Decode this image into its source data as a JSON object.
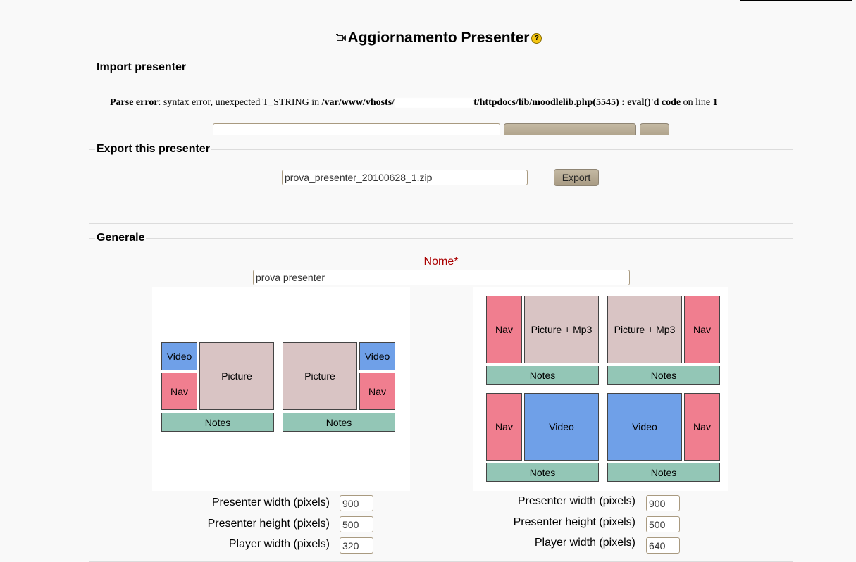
{
  "page": {
    "title": "Aggiornamento Presenter",
    "help_icon_glyph": "?"
  },
  "import_section": {
    "legend": "Import presenter",
    "error_label": "Parse error",
    "error_message": ": syntax error, unexpected T_STRING in ",
    "error_path_start": "/var/www/vhosts/",
    "error_path_end": "t/httpdocs/lib/moodlelib.php(5545) : eval()'d code",
    "error_on_line": " on line ",
    "error_line": "1"
  },
  "export_section": {
    "legend": "Export this presenter",
    "filename_value": "prova_presenter_20100628_1.zip",
    "export_button": "Export"
  },
  "general_section": {
    "legend": "Generale",
    "name_label": "Nome",
    "required_mark": "*",
    "name_value": "prova presenter"
  },
  "layout_labels": {
    "video": "Video",
    "nav": "Nav",
    "picture": "Picture",
    "picture_mp3": "Picture + Mp3",
    "notes": "Notes"
  },
  "left_dims": {
    "width_label": "Presenter width (pixels)",
    "width_value": "900",
    "height_label": "Presenter height (pixels)",
    "height_value": "500",
    "player_label": "Player width (pixels)",
    "player_value": "320"
  },
  "right_dims": {
    "width_label": "Presenter width (pixels)",
    "width_value": "900",
    "height_label": "Presenter height (pixels)",
    "height_value": "500",
    "player_label": "Player width (pixels)",
    "player_value": "640"
  },
  "colors": {
    "video": "#6fa0e8",
    "nav": "#f07e8f",
    "picture": "#d9c4c4",
    "notes": "#93c6b6",
    "required": "#aa0000"
  }
}
